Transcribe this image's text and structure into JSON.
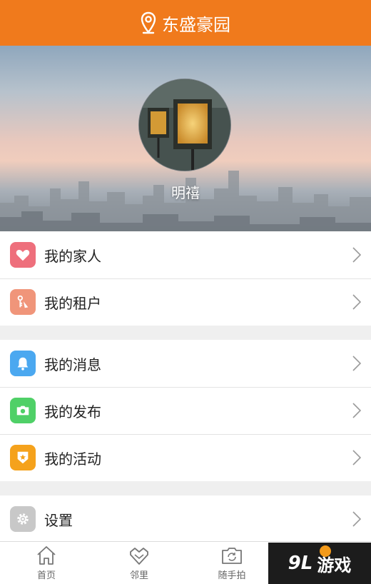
{
  "header": {
    "title": "东盛豪园",
    "icon": "location-pin-icon"
  },
  "profile": {
    "name": "明禧"
  },
  "menu_groups": [
    [
      {
        "label": "我的家人",
        "icon": "heart-icon",
        "color": "#ee6f7c"
      },
      {
        "label": "我的租户",
        "icon": "tenant-key-icon",
        "color": "#f0957a"
      }
    ],
    [
      {
        "label": "我的消息",
        "icon": "bell-icon",
        "color": "#4ba8f0"
      },
      {
        "label": "我的发布",
        "icon": "camera-icon",
        "color": "#4fd067"
      },
      {
        "label": "我的活动",
        "icon": "badge-star-icon",
        "color": "#f5a21c"
      }
    ],
    [
      {
        "label": "设置",
        "icon": "gear-icon",
        "color": "#c8c8c8"
      }
    ]
  ],
  "tabbar": [
    {
      "label": "首页",
      "icon": "home-icon"
    },
    {
      "label": "邻里",
      "icon": "handshake-icon"
    },
    {
      "label": "随手拍",
      "icon": "camera-rotate-icon"
    }
  ],
  "watermark": {
    "brand": "9L",
    "text": "游戏"
  },
  "colors": {
    "primary": "#f07a1c",
    "background": "#efefef"
  }
}
